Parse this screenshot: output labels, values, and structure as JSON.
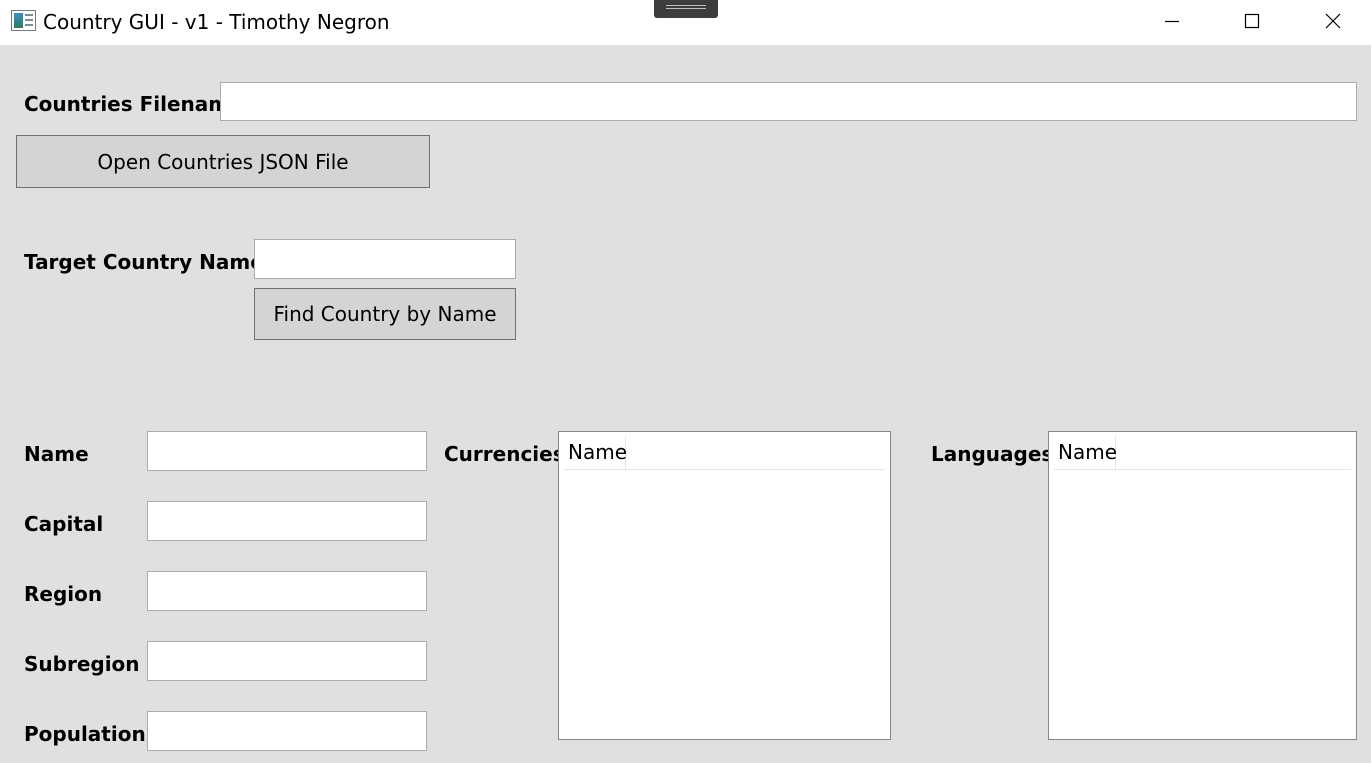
{
  "window": {
    "title": "Country GUI - v1 - Timothy Negron",
    "icon": "app-window-icon",
    "controls": [
      "minimize-icon",
      "maximize-icon",
      "close-icon"
    ]
  },
  "file": {
    "label": "Countries Filename",
    "value": "",
    "open_button": "Open Countries JSON File"
  },
  "search": {
    "label": "Target Country Name",
    "value": "",
    "find_button": "Find Country by Name"
  },
  "details": {
    "name_label": "Name",
    "name_value": "",
    "capital_label": "Capital",
    "capital_value": "",
    "region_label": "Region",
    "region_value": "",
    "subregion_label": "Subregion",
    "subregion_value": "",
    "population_label": "Population",
    "population_value": ""
  },
  "currencies": {
    "label": "Currencies",
    "column": "Name",
    "rows": []
  },
  "languages": {
    "label": "Languages",
    "column": "Name",
    "rows": []
  }
}
